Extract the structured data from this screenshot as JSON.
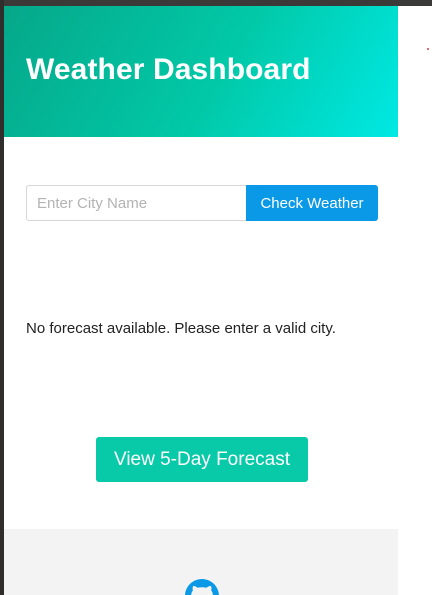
{
  "header": {
    "title": "Weather Dashboard",
    "gradient_start": "#05a889",
    "gradient_end": "#00e9e4"
  },
  "search": {
    "placeholder": "Enter City Name",
    "value": "",
    "button_label": "Check Weather",
    "button_color": "#0a99e6"
  },
  "forecast": {
    "status_message": "No forecast available. Please enter a valid city.",
    "button_label": "View 5-Day Forecast",
    "button_color": "#08c9a8"
  },
  "footer": {
    "icon": "github-icon",
    "icon_color": "#0a99e6"
  }
}
